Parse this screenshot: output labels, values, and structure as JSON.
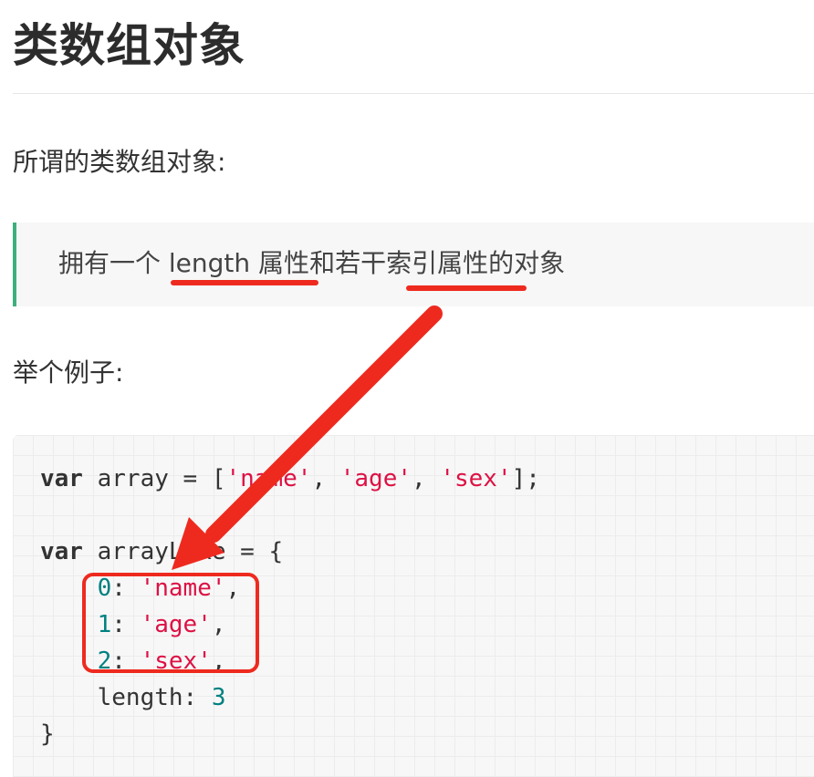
{
  "title": "类数组对象",
  "intro": "所谓的类数组对象:",
  "quote": {
    "text_1": "拥有一个 ",
    "text_2": "length 属性",
    "text_3": "和若干",
    "text_4": "索引属性",
    "text_5": "的对象"
  },
  "example_intro": "举个例子:",
  "code": {
    "line1": {
      "kw": "var",
      "ident": " array = [",
      "s1": "'name'",
      "sep1": ", ",
      "s2": "'age'",
      "sep2": ", ",
      "s3": "'sex'",
      "end": "];"
    },
    "line3": {
      "kw": "var",
      "ident": " arrayLike = {"
    },
    "line4": {
      "key": "0",
      "colon": ": ",
      "val": "'name'",
      "comma": ","
    },
    "line5": {
      "key": "1",
      "colon": ": ",
      "val": "'age'",
      "comma": ","
    },
    "line6": {
      "key": "2",
      "colon": ": ",
      "val": "'sex'",
      "comma": ","
    },
    "line7": {
      "key": "length",
      "colon": ": ",
      "val": "3"
    },
    "line8": "}"
  },
  "annotation": {
    "color": "#ee2a1f",
    "underline_targets": [
      "length 属性",
      "索引属性"
    ],
    "box_target": "0: 'name', 1: 'age', 2: 'sex',"
  }
}
